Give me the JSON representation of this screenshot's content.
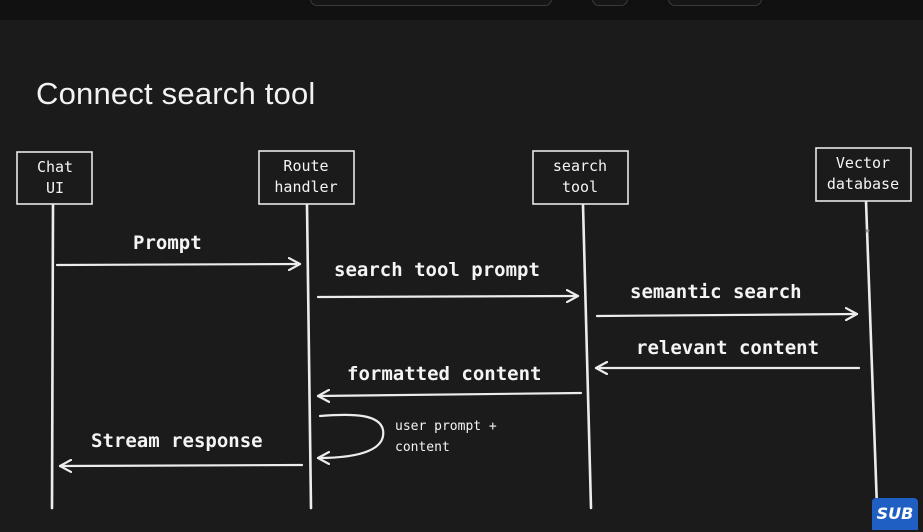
{
  "slide": {
    "title": "Connect search tool"
  },
  "participants": [
    {
      "id": "chat_ui",
      "lines": [
        "Chat",
        "UI"
      ]
    },
    {
      "id": "route_handler",
      "lines": [
        "Route",
        "handler"
      ]
    },
    {
      "id": "search_tool",
      "lines": [
        "search",
        "tool"
      ]
    },
    {
      "id": "vector_db",
      "lines": [
        "Vector",
        "database"
      ]
    }
  ],
  "messages": [
    {
      "label": "Prompt",
      "from": "chat_ui",
      "to": "route_handler"
    },
    {
      "label": "search tool prompt",
      "from": "route_handler",
      "to": "search_tool"
    },
    {
      "label": "semantic search",
      "from": "search_tool",
      "to": "vector_db"
    },
    {
      "label": "relevant content",
      "from": "vector_db",
      "to": "search_tool"
    },
    {
      "label": "formatted content",
      "from": "search_tool",
      "to": "route_handler"
    },
    {
      "label": "Stream response",
      "from": "route_handler",
      "to": "chat_ui"
    }
  ],
  "self_note": {
    "participant": "route_handler",
    "lines": [
      "user prompt +",
      "content"
    ]
  },
  "badge": {
    "text": "SUB"
  },
  "colors": {
    "background": "#1b1b1b",
    "ink": "#ececec",
    "badge": "#1f5fc4"
  }
}
